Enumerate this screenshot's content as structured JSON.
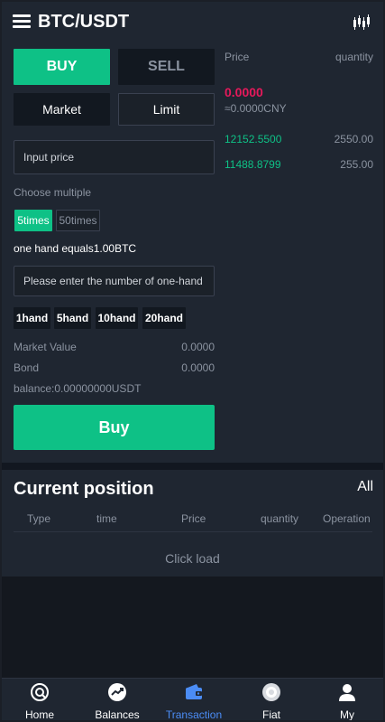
{
  "header": {
    "title": "BTC/USDT",
    "kline_icon": "candlestick-chart-icon",
    "menu_icon": "hamburger-menu-icon"
  },
  "trade": {
    "buy_tab": "BUY",
    "sell_tab": "SELL",
    "market_tab": "Market",
    "limit_tab": "Limit",
    "price_placeholder": "Input price",
    "choose_multiple_label": "Choose multiple",
    "multiples": [
      "5times",
      "50times"
    ],
    "selected_multiple": "5times",
    "one_hand_text": "one hand equals1.00BTC",
    "hands_placeholder": "Please enter the number of one-hand",
    "hands": [
      "1hand",
      "5hand",
      "10hand",
      "20hand"
    ],
    "market_value_label": "Market Value",
    "market_value": "0.0000",
    "bond_label": "Bond",
    "bond": "0.0000",
    "balance_text": "balance:0.00000000USDT",
    "buy_button": "Buy"
  },
  "orderbook": {
    "price_header": "Price",
    "quantity_header": "quantity",
    "current_price": "0.0000",
    "cny_value": "≈0.0000CNY",
    "rows": [
      {
        "price": "12152.5500",
        "quantity": "2550.00"
      },
      {
        "price": "11488.8799",
        "quantity": "255.00"
      }
    ],
    "colors": {
      "up": "#0ec186",
      "down": "#e6195b"
    }
  },
  "position": {
    "title": "Current position",
    "all_link": "All",
    "columns": [
      "Type",
      "time",
      "Price",
      "quantity",
      "Operation"
    ],
    "click_load": "Click load"
  },
  "nav": {
    "items": [
      {
        "label": "Home",
        "icon": "home-icon"
      },
      {
        "label": "Balances",
        "icon": "balances-chart-icon"
      },
      {
        "label": "Transaction",
        "icon": "wallet-icon"
      },
      {
        "label": "Fiat",
        "icon": "fiat-coin-icon"
      },
      {
        "label": "My",
        "icon": "user-icon"
      }
    ],
    "active": "Transaction",
    "active_color": "#4b8cf5"
  }
}
